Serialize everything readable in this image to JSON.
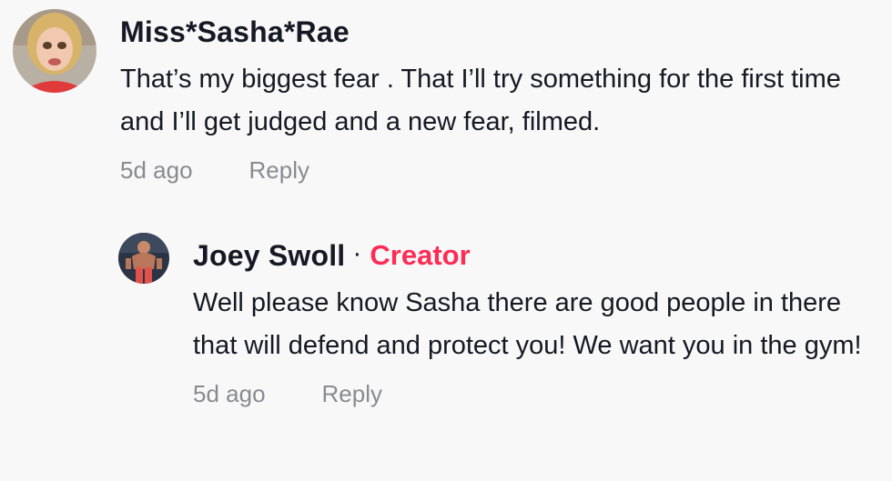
{
  "comments": [
    {
      "author": "Miss*Sasha*Rae",
      "text": "That’s my biggest fear . That I’ll try something for the first time and I’ll get judged and a new fear, filmed.",
      "time": "5d ago",
      "reply_label": "Reply"
    }
  ],
  "reply": {
    "author": "Joey Swoll",
    "separator": "·",
    "badge": "Creator",
    "text": "Well please know Sasha there are good people in there that will defend and protect you! We want you in the gym!",
    "time": "5d ago",
    "reply_label": "Reply"
  },
  "colors": {
    "background": "#f8f8f8",
    "text": "#161823",
    "muted": "#8a8b91",
    "creator_badge": "#fe2c55"
  },
  "icons": {
    "avatar_main": "user-avatar-photo",
    "avatar_reply": "user-avatar-photo"
  }
}
